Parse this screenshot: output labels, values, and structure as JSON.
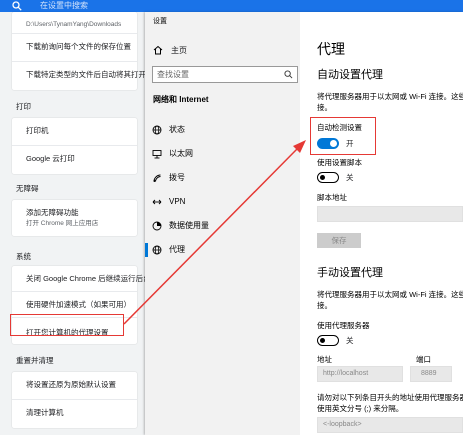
{
  "chrome": {
    "search_placeholder": "在设置中搜索",
    "downloads": {
      "path": "D:\\Users\\TynamYang\\Downloads",
      "ask_each": "下载前询问每个文件的保存位置",
      "auto_open": "下载特定类型的文件后自动将其打开"
    },
    "print": {
      "heading": "打印",
      "printer": "打印机",
      "cloud_print": "Google 云打印"
    },
    "accessibility": {
      "heading": "无障碍",
      "add_features": "添加无障碍功能",
      "add_features_sub": "打开 Chrome 网上应用店"
    },
    "system": {
      "heading": "系统",
      "background_apps": "关闭 Google Chrome 后继续运行后台应用",
      "hardware_accel": "使用硬件加速模式（如果可用）",
      "open_proxy": "打开您计算机的代理设置"
    },
    "reset": {
      "heading": "重置并清理",
      "restore": "将设置还原为原始默认设置",
      "cleanup": "清理计算机"
    }
  },
  "settings": {
    "window_title": "设置",
    "home": "主页",
    "search_placeholder": "查找设置",
    "category": "网络和 Internet",
    "nav_items": [
      {
        "label": "状态",
        "icon": "globe-icon"
      },
      {
        "label": "以太网",
        "icon": "ethernet-icon"
      },
      {
        "label": "拨号",
        "icon": "phone-icon"
      },
      {
        "label": "VPN",
        "icon": "vpn-icon"
      },
      {
        "label": "数据使用量",
        "icon": "data-usage-icon"
      },
      {
        "label": "代理",
        "icon": "globe-icon"
      }
    ],
    "page_title": "代理",
    "auto": {
      "heading": "自动设置代理",
      "desc_line1": "将代理服务器用于以太网或 Wi-Fi 连接。这些",
      "desc_line2": "接。",
      "detect_label": "自动检测设置",
      "detect_state": "开",
      "script_label": "使用设置脚本",
      "script_state": "关",
      "script_address_label": "脚本地址",
      "save_button": "保存"
    },
    "manual": {
      "heading": "手动设置代理",
      "desc_line1": "将代理服务器用于以太网或 Wi-Fi 连接。这些",
      "desc_line2": "接。",
      "use_proxy_label": "使用代理服务器",
      "use_proxy_state": "关",
      "address_label": "地址",
      "address_value": "http://localhost",
      "port_label": "端口",
      "port_value": "8889",
      "exceptions_line1": "请勿对以下列条目开头的地址使用代理服务器",
      "exceptions_line2": "使用英文分号 (;) 来分隔。",
      "exceptions_value": "<-loopback>"
    }
  },
  "annotation_color": "#e53935",
  "accent_color": "#0078d7"
}
